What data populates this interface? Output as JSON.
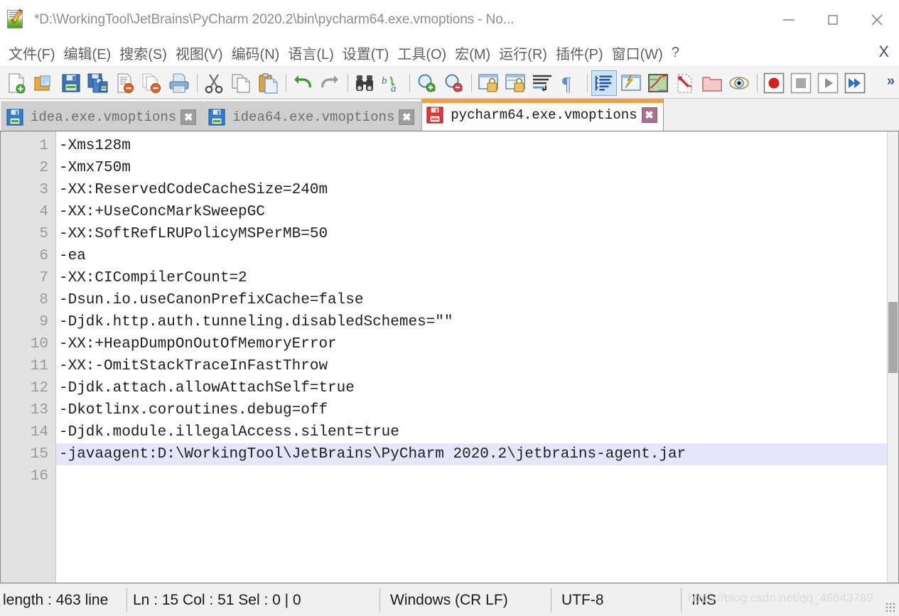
{
  "window": {
    "title": "*D:\\WorkingTool\\JetBrains\\PyCharm 2020.2\\bin\\pycharm64.exe.vmoptions - No...",
    "app_icon": "notepad-plus-plus-icon",
    "minimize_label": "–",
    "maximize_label": "□",
    "close_label": "✕"
  },
  "menubar": {
    "items": [
      {
        "label": "文件(F)",
        "name": "menu-file"
      },
      {
        "label": "编辑(E)",
        "name": "menu-edit"
      },
      {
        "label": "搜索(S)",
        "name": "menu-search"
      },
      {
        "label": "视图(V)",
        "name": "menu-view"
      },
      {
        "label": "编码(N)",
        "name": "menu-encoding"
      },
      {
        "label": "语言(L)",
        "name": "menu-language"
      },
      {
        "label": "设置(T)",
        "name": "menu-settings"
      },
      {
        "label": "工具(O)",
        "name": "menu-tools"
      },
      {
        "label": "宏(M)",
        "name": "menu-macro"
      },
      {
        "label": "运行(R)",
        "name": "menu-run"
      },
      {
        "label": "插件(P)",
        "name": "menu-plugins"
      },
      {
        "label": "窗口(W)",
        "name": "menu-window"
      },
      {
        "label": "?",
        "name": "menu-help"
      }
    ],
    "close_doc_label": "X"
  },
  "toolbar": {
    "overflow_label": "»",
    "items": [
      "new-file-icon",
      "open-file-icon",
      "save-icon",
      "save-all-icon",
      "close-file-icon",
      "close-all-icon",
      "print-icon",
      "separator",
      "cut-icon",
      "copy-icon",
      "paste-icon",
      "separator",
      "undo-icon",
      "redo-icon",
      "separator",
      "find-icon",
      "replace-icon",
      "separator",
      "zoom-in-icon",
      "zoom-out-icon",
      "separator",
      "sync-vertical-scroll-icon",
      "sync-horizontal-scroll-icon",
      "word-wrap-icon",
      "show-all-characters-icon",
      "separator",
      "indent-guideline-icon",
      "user-defined-dialog-icon",
      "show-whitespace-icon",
      "tab-settings-icon",
      "folder-as-workspace-icon",
      "document-map-icon",
      "separator",
      "record-macro-icon",
      "stop-record-macro-icon",
      "play-macro-icon",
      "run-macro-multiple-icon"
    ]
  },
  "tabs": [
    {
      "label": "idea.exe.vmoptions",
      "active": false,
      "modified": false,
      "icon": "save-blue-icon",
      "close": "✖"
    },
    {
      "label": "idea64.exe.vmoptions",
      "active": false,
      "modified": false,
      "icon": "save-blue-icon",
      "close": "✖"
    },
    {
      "label": "pycharm64.exe.vmoptions",
      "active": true,
      "modified": true,
      "icon": "save-red-icon",
      "close": "✖"
    }
  ],
  "editor": {
    "current_line": 15,
    "lines": [
      {
        "no": "1",
        "text": "-Xms128m"
      },
      {
        "no": "2",
        "text": "-Xmx750m"
      },
      {
        "no": "3",
        "text": "-XX:ReservedCodeCacheSize=240m"
      },
      {
        "no": "4",
        "text": "-XX:+UseConcMarkSweepGC"
      },
      {
        "no": "5",
        "text": "-XX:SoftRefLRUPolicyMSPerMB=50"
      },
      {
        "no": "6",
        "text": "-ea"
      },
      {
        "no": "7",
        "text": "-XX:CICompilerCount=2"
      },
      {
        "no": "8",
        "text": "-Dsun.io.useCanonPrefixCache=false"
      },
      {
        "no": "9",
        "text": "-Djdk.http.auth.tunneling.disabledSchemes=\"\""
      },
      {
        "no": "10",
        "text": "-XX:+HeapDumpOnOutOfMemoryError"
      },
      {
        "no": "11",
        "text": "-XX:-OmitStackTraceInFastThrow"
      },
      {
        "no": "12",
        "text": "-Djdk.attach.allowAttachSelf=true"
      },
      {
        "no": "13",
        "text": "-Dkotlinx.coroutines.debug=off"
      },
      {
        "no": "14",
        "text": "-Djdk.module.illegalAccess.silent=true"
      },
      {
        "no": "15",
        "text": "-javaagent:D:\\WorkingTool\\JetBrains\\PyCharm 2020.2\\jetbrains-agent.jar"
      },
      {
        "no": "16",
        "text": ""
      }
    ]
  },
  "statusbar": {
    "doc_info": "length : 463    line",
    "position": "Ln : 15    Col : 51    Sel : 0 | 0",
    "eol": "Windows (CR LF)",
    "encoding": "UTF-8",
    "insert_mode": "INS",
    "watermark": "https://blog.csdn.net/qq_46643789"
  },
  "colors": {
    "tab_active_accent": "#f2a33c",
    "current_line_highlight": "#e6e6fa",
    "gutter_bg": "#e2e2e2",
    "toolbar_bg": "#f4f4f4",
    "window_bg": "#f0f0f0"
  }
}
